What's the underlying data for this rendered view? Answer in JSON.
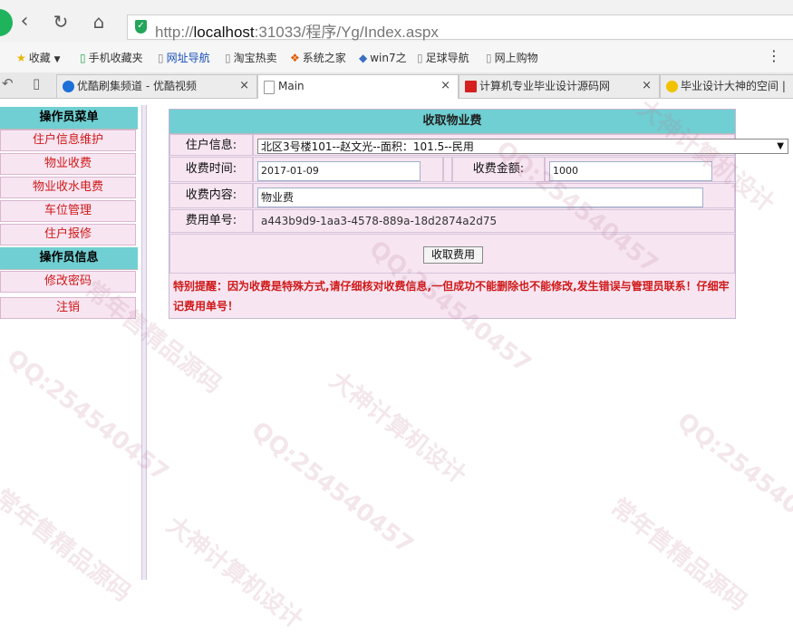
{
  "browser": {
    "url_prefix": "http://",
    "url_host": "localhost",
    "url_rest": ":31033/程序/Yg/Index.aspx",
    "bookmarks": [
      "收藏",
      "手机收藏夹",
      "网址导航",
      "淘宝热卖",
      "系统之家",
      "win7之",
      "足球导航",
      "网上购物"
    ],
    "tabs": [
      {
        "label": "优酷刷集频道 - 优酷视频"
      },
      {
        "label": "Main"
      },
      {
        "label": "计算机专业毕业设计源码网"
      },
      {
        "label": "毕业设计大神的空间 |"
      }
    ]
  },
  "menu": {
    "header1": "操作员菜单",
    "items": [
      "住户信息维护",
      "物业收费",
      "物业收水电费",
      "车位管理",
      "住户报修"
    ],
    "header2": "操作员信息",
    "items2": [
      "修改密码",
      "注销"
    ]
  },
  "form": {
    "title": "收取物业费",
    "resident_label": "住户信息:",
    "resident_value": "北区3号楼101--赵文光--面积：101.5--民用",
    "time_label": "收费时间:",
    "time_value": "2017-01-09",
    "amount_label": "收费金额:",
    "amount_value": "1000",
    "content_label": "收费内容:",
    "content_value": "物业费",
    "bill_label": "费用单号:",
    "bill_value": "a443b9d9-1aa3-4578-889a-18d2874a2d75",
    "submit_label": "收取费用",
    "note": "特别提醒：因为收费是特殊方式,请仔细核对收费信息,一但成功不能删除也不能修改,发生错误与管理员联系！仔细牢记费用单号！"
  },
  "watermarks": [
    "QQ:254540457",
    "大神计算机设计",
    "常年售精品源码"
  ],
  "colors": {
    "header_teal": "#6fcfd2",
    "menu_pink": "#f7e6f2",
    "menu_text_red": "#d01818"
  }
}
